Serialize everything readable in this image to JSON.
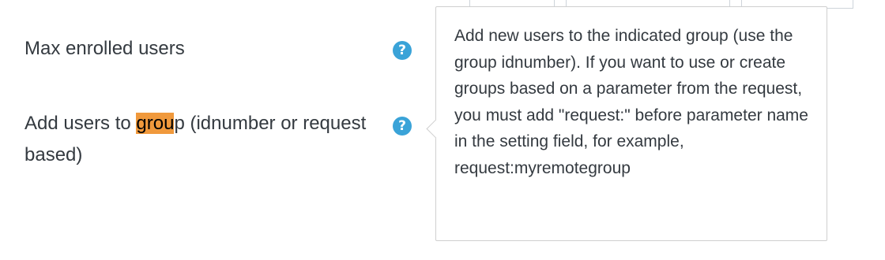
{
  "settings": {
    "max_enrolled_users": {
      "label": "Max enrolled users",
      "help_icon": "question-circle-icon",
      "help_glyph": "?"
    },
    "add_users_to_group": {
      "label_before": "Add users to ",
      "label_highlight": "grou",
      "label_after": "p (idnumber or request based)",
      "help_icon": "question-circle-icon",
      "help_glyph": "?"
    }
  },
  "popover": {
    "text": "Add new users to the indicated group (use the group idnumber). If you want to use or create groups based on a parameter from the request, you must add \"request:\" before parameter name in the setting field, for example, request:myremotegroup"
  },
  "colors": {
    "help_icon": "#3aa3d8",
    "search_highlight": "#f0993c",
    "text": "#343a40",
    "popover_border": "#cfcfcf"
  }
}
